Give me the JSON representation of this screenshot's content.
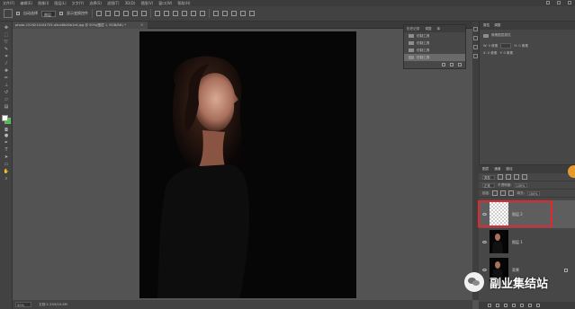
{
  "menubar": {
    "items": [
      "文件(F)",
      "编辑(E)",
      "图像(I)",
      "图层(L)",
      "文字(Y)",
      "选择(S)",
      "滤镜(T)",
      "3D(D)",
      "视图(V)",
      "窗口(W)",
      "帮助(H)"
    ]
  },
  "options": {
    "auto_select_label": "自动选择",
    "auto_select_target": "图层",
    "show_transform_label": "显示变换控件"
  },
  "document": {
    "tab_title": "photo-1516214104703-d4cd8b26b1c6.jpg @ 50%(图层 1, RGB/8#) *"
  },
  "history": {
    "tabs": [
      "历史记录",
      "调整",
      "库"
    ],
    "items": [
      "仿制工具",
      "仿制工具",
      "仿制工具",
      "仿制工具"
    ]
  },
  "properties": {
    "tabs": [
      "属性",
      "调整"
    ],
    "title": "像素图层属性",
    "w_label": "W: 0 像素",
    "h_label": "H: 0 像素",
    "x_label": "X: 0 像素",
    "y_label": "Y: 0 像素"
  },
  "layers": {
    "tabs": [
      "图层",
      "通道",
      "路径"
    ],
    "kind_label": "类型",
    "blend_mode": "正常",
    "opacity_label": "不透明度:",
    "opacity_value": "100%",
    "lock_label": "锁定:",
    "fill_label": "填充:",
    "fill_value": "100%",
    "items": [
      {
        "name": "图层 2"
      },
      {
        "name": "图层 1"
      },
      {
        "name": "背景"
      }
    ]
  },
  "status": {
    "zoom": "50%",
    "doc_info": "文档:5.31M/10.6M"
  },
  "watermark": {
    "text": "副业集结站"
  },
  "colors": {
    "foreground": "#ffffff",
    "background": "#18e018",
    "highlight": "#e0292e"
  }
}
